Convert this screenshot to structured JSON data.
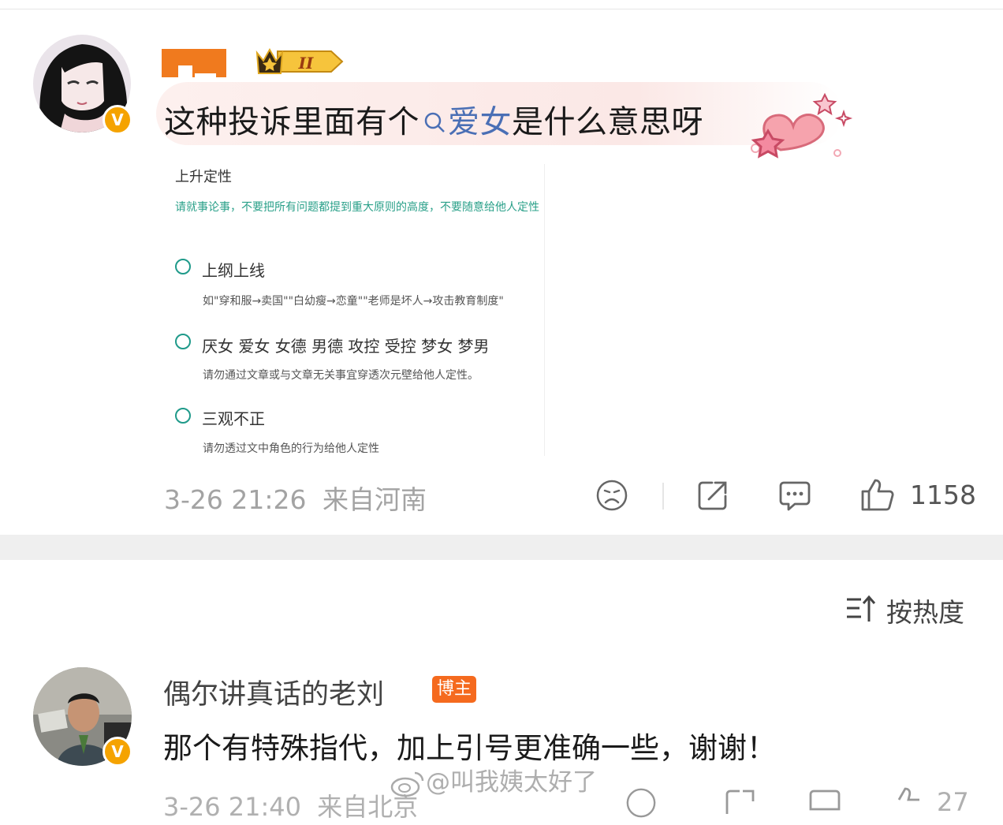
{
  "post": {
    "text_before": "这种投诉里面有个",
    "topic": "爱女",
    "text_after": "是什么意思呀",
    "level_badge": "II",
    "verified_mark": "V",
    "time": "3-26 21:26",
    "source": "来自河南",
    "like_count": "1158",
    "icons": [
      "sad-face-icon",
      "share-icon",
      "comment-icon",
      "thumbs-up-icon"
    ]
  },
  "screenshot": {
    "title": "上升定性",
    "warning": "请就事论事，不要把所有问题都提到重大原则的高度，不要随意给他人定性",
    "options": [
      {
        "title": "上纲上线",
        "desc": "如\"穿和服→卖国\"\"白幼瘦→恋童\"\"老师是坏人→攻击教育制度\""
      },
      {
        "title": "厌女 爱女 女德 男德 攻控 受控 梦女 梦男",
        "desc": "请勿通过文章或与文章无关事宜穿透次元壁给他人定性。"
      },
      {
        "title": "三观不正",
        "desc": "请勿透过文中角色的行为给他人定性"
      }
    ]
  },
  "sort": {
    "label": "按热度"
  },
  "comment": {
    "username": "偶尔讲真话的老刘",
    "badge": "博主",
    "verified_mark": "V",
    "text": "那个有特殊指代，加上引号更准确一些，谢谢！",
    "time": "3-26 21:40",
    "source": "来自北京",
    "like_count": "27"
  },
  "watermark": "@叫我姨太好了",
  "colors": {
    "accent_orange": "#f07a1e",
    "topic_blue": "#4a6fb5",
    "teal": "#1f9a8a",
    "vip_gold": "#f5a300"
  }
}
